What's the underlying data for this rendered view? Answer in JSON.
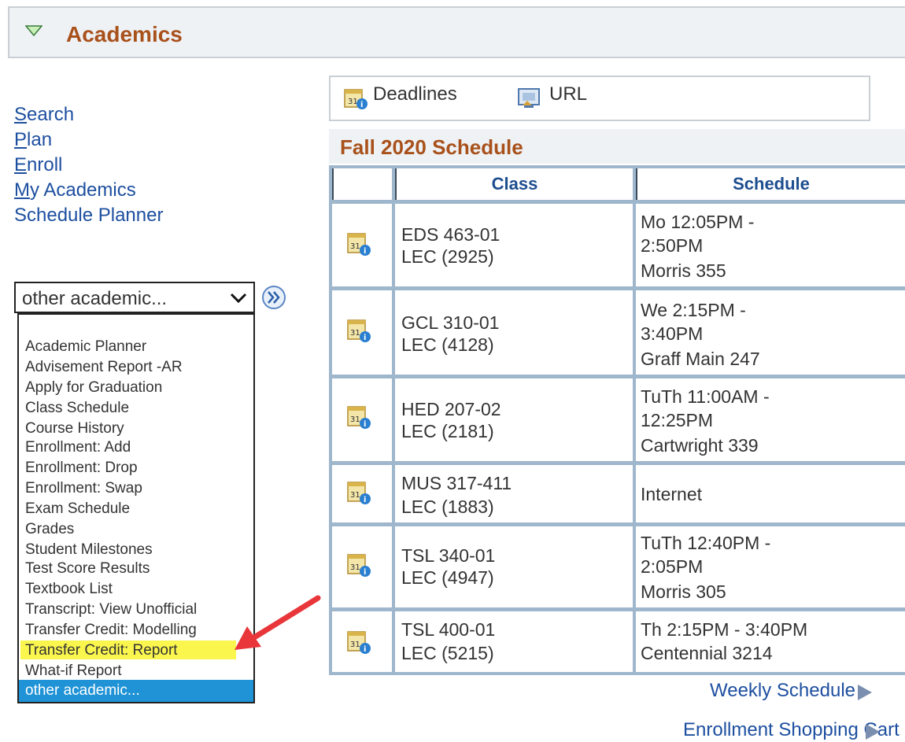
{
  "header": {
    "title": "Academics"
  },
  "nav": {
    "links": [
      {
        "first": "S",
        "rest": "earch"
      },
      {
        "first": "P",
        "rest": "lan"
      },
      {
        "first": "E",
        "rest": "nroll"
      },
      {
        "first": "M",
        "rest": "y Academics"
      },
      {
        "first": "",
        "rest": "Schedule Planner"
      }
    ]
  },
  "select": {
    "value": "other academic...",
    "options": [
      "Academic Planner",
      "Advisement Report -AR",
      "Apply for Graduation",
      "Class Schedule",
      "Course History",
      "Enrollment: Add",
      "Enrollment: Drop",
      "Enrollment: Swap",
      "Exam Schedule",
      "Grades",
      "Student Milestones",
      "Test Score Results",
      "Textbook List",
      "Transcript: View Unofficial",
      "Transfer Credit: Modelling",
      "Transfer Credit: Report",
      "What-if Report",
      "other academic..."
    ],
    "highlighted": "Transfer Credit: Report",
    "selected": "other academic..."
  },
  "toolbar": {
    "deadlines": "Deadlines",
    "url": "URL"
  },
  "schedule": {
    "title": "Fall 2020 Schedule",
    "columns": {
      "class": "Class",
      "schedule": "Schedule"
    },
    "rows": [
      {
        "class1": "EDS 463-01",
        "class2": "LEC (2925)",
        "sched": [
          "Mo 12:05PM -",
          "2:50PM",
          "Morris 355"
        ]
      },
      {
        "class1": "GCL 310-01",
        "class2": "LEC (4128)",
        "sched": [
          "We 2:15PM -",
          "3:40PM",
          "Graff Main 247"
        ]
      },
      {
        "class1": "HED 207-02",
        "class2": "LEC (2181)",
        "sched": [
          "TuTh 11:00AM -",
          "12:25PM",
          "Cartwright 339"
        ]
      },
      {
        "class1": "MUS 317-411",
        "class2": "LEC (1883)",
        "sched": [
          "Internet"
        ]
      },
      {
        "class1": "TSL 340-01",
        "class2": "LEC (4947)",
        "sched": [
          "TuTh 12:40PM -",
          "2:05PM",
          "Morris 305"
        ]
      },
      {
        "class1": "TSL 400-01",
        "class2": "LEC (5215)",
        "sched": [
          "Th 2:15PM - 3:40PM",
          "Centennial 3214"
        ]
      }
    ]
  },
  "links": {
    "weekly": "Weekly Schedule",
    "cart": "Enrollment Shopping Cart"
  },
  "colors": {
    "accent": "#a9511b",
    "link": "#1d4fa0",
    "highlight": "#fbf64e",
    "selected": "#1f93d6",
    "arrow": "#e8363a"
  }
}
